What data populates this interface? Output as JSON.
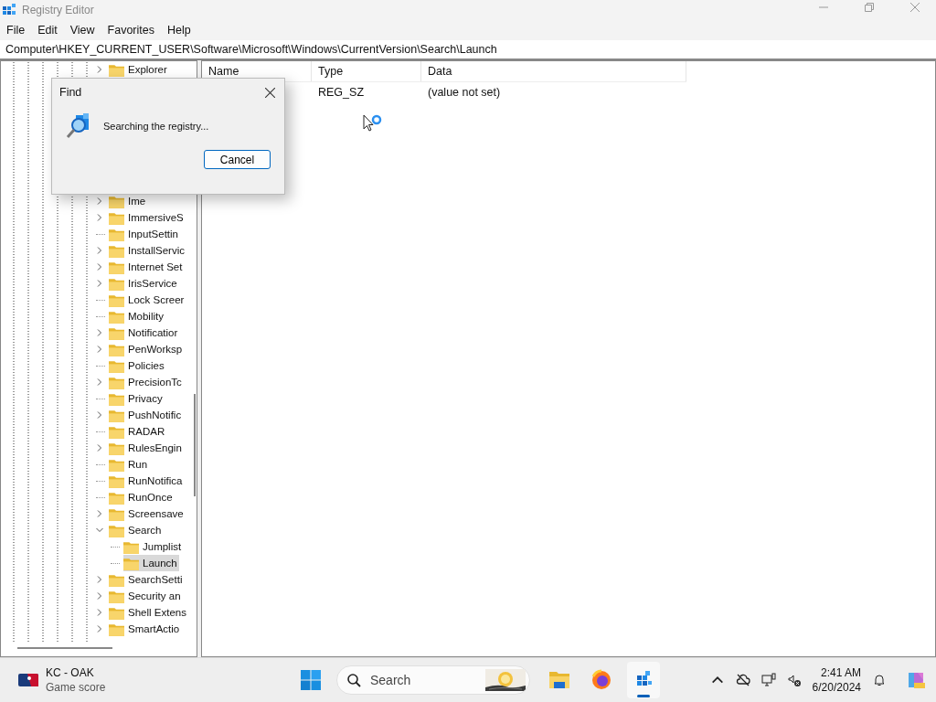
{
  "window": {
    "title": "Registry Editor"
  },
  "menu": [
    "File",
    "Edit",
    "View",
    "Favorites",
    "Help"
  ],
  "address": "Computer\\HKEY_CURRENT_USER\\Software\\Microsoft\\Windows\\CurrentVersion\\Search\\Launch",
  "tree": [
    {
      "label": "Explorer",
      "expandable": true,
      "expanded": false,
      "selected": false
    },
    {
      "label": "Ime",
      "expandable": true,
      "expanded": false,
      "selected": false
    },
    {
      "label": "ImmersiveS",
      "expandable": true,
      "expanded": false,
      "selected": false
    },
    {
      "label": "InputSettin",
      "expandable": false,
      "expanded": false,
      "selected": false
    },
    {
      "label": "InstallServic",
      "expandable": true,
      "expanded": false,
      "selected": false
    },
    {
      "label": "Internet Set",
      "expandable": true,
      "expanded": false,
      "selected": false
    },
    {
      "label": "IrisService",
      "expandable": true,
      "expanded": false,
      "selected": false
    },
    {
      "label": "Lock Screer",
      "expandable": false,
      "expanded": false,
      "selected": false
    },
    {
      "label": "Mobility",
      "expandable": false,
      "expanded": false,
      "selected": false
    },
    {
      "label": "Notificatior",
      "expandable": true,
      "expanded": false,
      "selected": false
    },
    {
      "label": "PenWorksp",
      "expandable": true,
      "expanded": false,
      "selected": false
    },
    {
      "label": "Policies",
      "expandable": false,
      "expanded": false,
      "selected": false
    },
    {
      "label": "PrecisionTc",
      "expandable": true,
      "expanded": false,
      "selected": false
    },
    {
      "label": "Privacy",
      "expandable": false,
      "expanded": false,
      "selected": false
    },
    {
      "label": "PushNotific",
      "expandable": true,
      "expanded": false,
      "selected": false
    },
    {
      "label": "RADAR",
      "expandable": false,
      "expanded": false,
      "selected": false
    },
    {
      "label": "RulesEngin",
      "expandable": true,
      "expanded": false,
      "selected": false
    },
    {
      "label": "Run",
      "expandable": false,
      "expanded": false,
      "selected": false
    },
    {
      "label": "RunNotifica",
      "expandable": false,
      "expanded": false,
      "selected": false
    },
    {
      "label": "RunOnce",
      "expandable": false,
      "expanded": false,
      "selected": false
    },
    {
      "label": "Screensave",
      "expandable": true,
      "expanded": false,
      "selected": false
    },
    {
      "label": "Search",
      "expandable": true,
      "expanded": true,
      "selected": false,
      "children": [
        {
          "label": "Jumplist",
          "expandable": false,
          "expanded": false,
          "selected": false
        },
        {
          "label": "Launch",
          "expandable": false,
          "expanded": false,
          "selected": true
        }
      ]
    },
    {
      "label": "SearchSetti",
      "expandable": true,
      "expanded": false,
      "selected": false
    },
    {
      "label": "Security an",
      "expandable": true,
      "expanded": false,
      "selected": false
    },
    {
      "label": "Shell Extens",
      "expandable": true,
      "expanded": false,
      "selected": false
    },
    {
      "label": "SmartActio",
      "expandable": true,
      "expanded": false,
      "selected": false
    }
  ],
  "values": {
    "columns": [
      "Name",
      "Type",
      "Data"
    ],
    "rows": [
      {
        "type": "REG_SZ",
        "data": "(value not set)"
      }
    ]
  },
  "find_dialog": {
    "title": "Find",
    "message": "Searching the registry...",
    "button": "Cancel"
  },
  "taskbar": {
    "widget": {
      "title": "KC - OAK",
      "subtitle": "Game score"
    },
    "search": {
      "placeholder": "Search"
    },
    "apps": [
      {
        "kind": "files",
        "active": false
      },
      {
        "kind": "browser",
        "active": false
      },
      {
        "kind": "registry",
        "active": true
      }
    ],
    "time": "2:41 AM",
    "date": "6/20/2024"
  }
}
